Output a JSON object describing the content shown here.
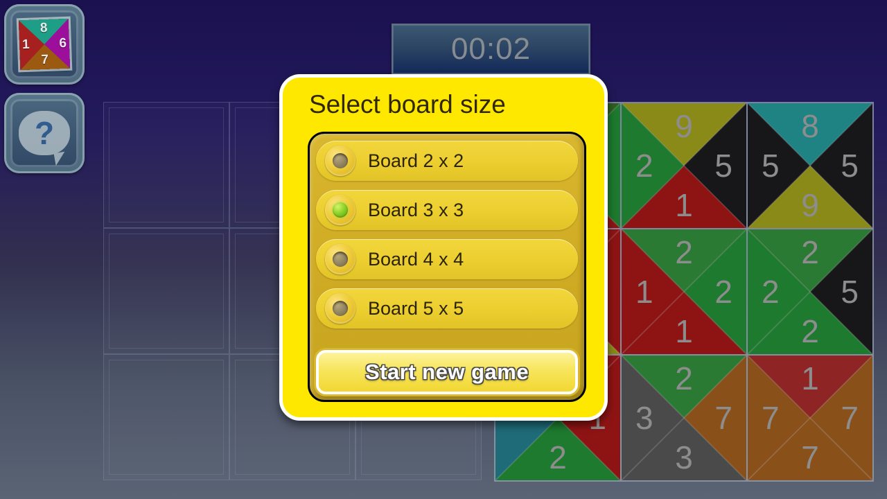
{
  "window": {
    "title": "Select board size"
  },
  "toolbar": {
    "app_icon": {
      "name": "app-icon",
      "triangles": [
        {
          "pos": "top",
          "value": "8",
          "color": "#1f9e87"
        },
        {
          "pos": "right",
          "value": "6",
          "color": "#9b0f9b"
        },
        {
          "pos": "bottom",
          "value": "7",
          "color": "#9c5a10"
        },
        {
          "pos": "left",
          "value": "1",
          "color": "#a72020"
        }
      ]
    },
    "help_button": {
      "name": "help-icon",
      "glyph": "?"
    }
  },
  "timer": {
    "label": "00:02",
    "color": "#878c92"
  },
  "dialog": {
    "title": "Select board size",
    "accent": "#ffe800",
    "panel_color": "#d0ab24",
    "selected_index": 1,
    "options": [
      {
        "label": "Board 2 x 2",
        "selected": false
      },
      {
        "label": "Board 3 x 3",
        "selected": true
      },
      {
        "label": "Board 4 x 4",
        "selected": false
      },
      {
        "label": "Board 5 x 5",
        "selected": false
      }
    ],
    "start_button": {
      "label": "Start new game"
    }
  },
  "empty_board": {
    "rows": 3,
    "cols": 3,
    "slots": [
      "",
      "",
      "",
      "",
      "",
      "",
      "",
      "",
      ""
    ]
  },
  "puzzle_board": {
    "rows": 3,
    "cols": 3,
    "tiles": [
      {
        "index": 0,
        "occluded": true,
        "triangles": [
          {
            "pos": "top",
            "value": "",
            "color": "#2f5f22"
          },
          {
            "pos": "right",
            "value": "",
            "color": "#1d7a2e"
          },
          {
            "pos": "bottom",
            "value": "",
            "color": "#8e1414"
          },
          {
            "pos": "left",
            "value": "",
            "color": "#1d7a2e"
          }
        ]
      },
      {
        "index": 1,
        "occluded": false,
        "triangles": [
          {
            "pos": "top",
            "value": "9",
            "color": "#8a8a18"
          },
          {
            "pos": "right",
            "value": "5",
            "color": "#17171a"
          },
          {
            "pos": "bottom",
            "value": "1",
            "color": "#8e1414"
          },
          {
            "pos": "left",
            "value": "2",
            "color": "#1d7a2e"
          }
        ]
      },
      {
        "index": 2,
        "occluded": false,
        "triangles": [
          {
            "pos": "top",
            "value": "8",
            "color": "#1f8383"
          },
          {
            "pos": "right",
            "value": "5",
            "color": "#17171a"
          },
          {
            "pos": "bottom",
            "value": "9",
            "color": "#8a8a18"
          },
          {
            "pos": "left",
            "value": "5",
            "color": "#17171a"
          }
        ]
      },
      {
        "index": 3,
        "occluded": true,
        "triangles": [
          {
            "pos": "top",
            "value": "",
            "color": "#8e1414"
          },
          {
            "pos": "right",
            "value": "",
            "color": "#8e1414"
          },
          {
            "pos": "bottom",
            "value": "",
            "color": "#8a8a18"
          },
          {
            "pos": "left",
            "value": "",
            "color": "#1f6b78"
          }
        ]
      },
      {
        "index": 4,
        "occluded": false,
        "triangles": [
          {
            "pos": "top",
            "value": "2",
            "color": "#2b7a34"
          },
          {
            "pos": "right",
            "value": "2",
            "color": "#1d7a2e"
          },
          {
            "pos": "bottom",
            "value": "1",
            "color": "#8e1414"
          },
          {
            "pos": "left",
            "value": "1",
            "color": "#8e1414"
          }
        ]
      },
      {
        "index": 5,
        "occluded": false,
        "triangles": [
          {
            "pos": "top",
            "value": "2",
            "color": "#2b7a34"
          },
          {
            "pos": "right",
            "value": "5",
            "color": "#17171a"
          },
          {
            "pos": "bottom",
            "value": "2",
            "color": "#1d7a2e"
          },
          {
            "pos": "left",
            "value": "2",
            "color": "#1d7a2e"
          }
        ]
      },
      {
        "index": 6,
        "occluded": true,
        "triangles": [
          {
            "pos": "top",
            "value": "",
            "color": "#8e1414"
          },
          {
            "pos": "right",
            "value": "1",
            "color": "#8e1414"
          },
          {
            "pos": "bottom",
            "value": "2",
            "color": "#1d7a2e"
          },
          {
            "pos": "left",
            "value": "",
            "color": "#1f6b78"
          }
        ]
      },
      {
        "index": 7,
        "occluded": false,
        "triangles": [
          {
            "pos": "top",
            "value": "2",
            "color": "#2b7a34"
          },
          {
            "pos": "right",
            "value": "7",
            "color": "#8a5019"
          },
          {
            "pos": "bottom",
            "value": "3",
            "color": "#4a4a4a"
          },
          {
            "pos": "left",
            "value": "3",
            "color": "#4a4a4a"
          }
        ]
      },
      {
        "index": 8,
        "occluded": false,
        "triangles": [
          {
            "pos": "top",
            "value": "1",
            "color": "#8e2424"
          },
          {
            "pos": "right",
            "value": "7",
            "color": "#8a5019"
          },
          {
            "pos": "bottom",
            "value": "7",
            "color": "#8a5019"
          },
          {
            "pos": "left",
            "value": "7",
            "color": "#8a5019"
          }
        ]
      }
    ]
  }
}
